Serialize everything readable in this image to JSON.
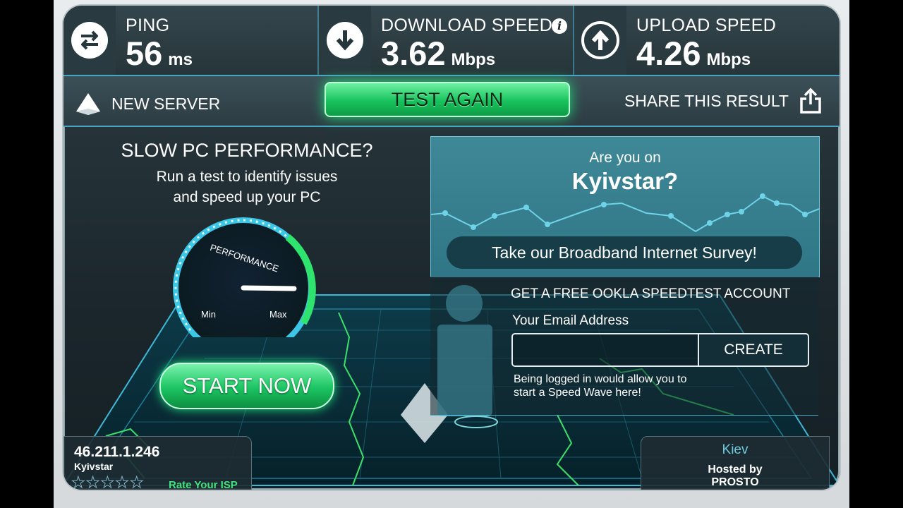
{
  "stats": {
    "ping": {
      "label": "PING",
      "value": "56",
      "unit": "ms"
    },
    "download": {
      "label": "DOWNLOAD SPEED",
      "value": "3.62",
      "unit": "Mbps",
      "info_icon": "info-icon"
    },
    "upload": {
      "label": "UPLOAD SPEED",
      "value": "4.26",
      "unit": "Mbps"
    }
  },
  "actions": {
    "new_server": "NEW SERVER",
    "test_again": "TEST AGAIN",
    "share": "SHARE THIS RESULT"
  },
  "ad": {
    "title": "SLOW PC PERFORMANCE?",
    "line1": "Run a test to identify issues",
    "line2": "and speed up your PC",
    "gauge_label": "PERFORMANCE",
    "gauge_min": "Min",
    "gauge_max": "Max",
    "gauge_level": 0.92,
    "start_button": "START NOW"
  },
  "survey": {
    "question_top": "Are you on",
    "provider": "Kyivstar?",
    "button": "Take our Broadband Internet Survey!"
  },
  "account": {
    "heading": "GET A FREE OOKLA SPEEDTEST ACCOUNT",
    "email_label": "Your Email Address",
    "email_value": "",
    "create_button": "CREATE",
    "note_line1": "Being logged in would allow you to",
    "note_line2": "start a Speed Wave here!"
  },
  "client": {
    "ip": "46.211.1.246",
    "isp": "Kyivstar",
    "stars": "★★★★★",
    "rate_label": "Rate Your ISP"
  },
  "server": {
    "city": "Kiev",
    "hosted_by": "Hosted by",
    "host": "PROSTO"
  },
  "colors": {
    "accent_green": "#1bc462",
    "accent_cyan": "#48a6c4",
    "panel_dark": "#1b272c"
  }
}
